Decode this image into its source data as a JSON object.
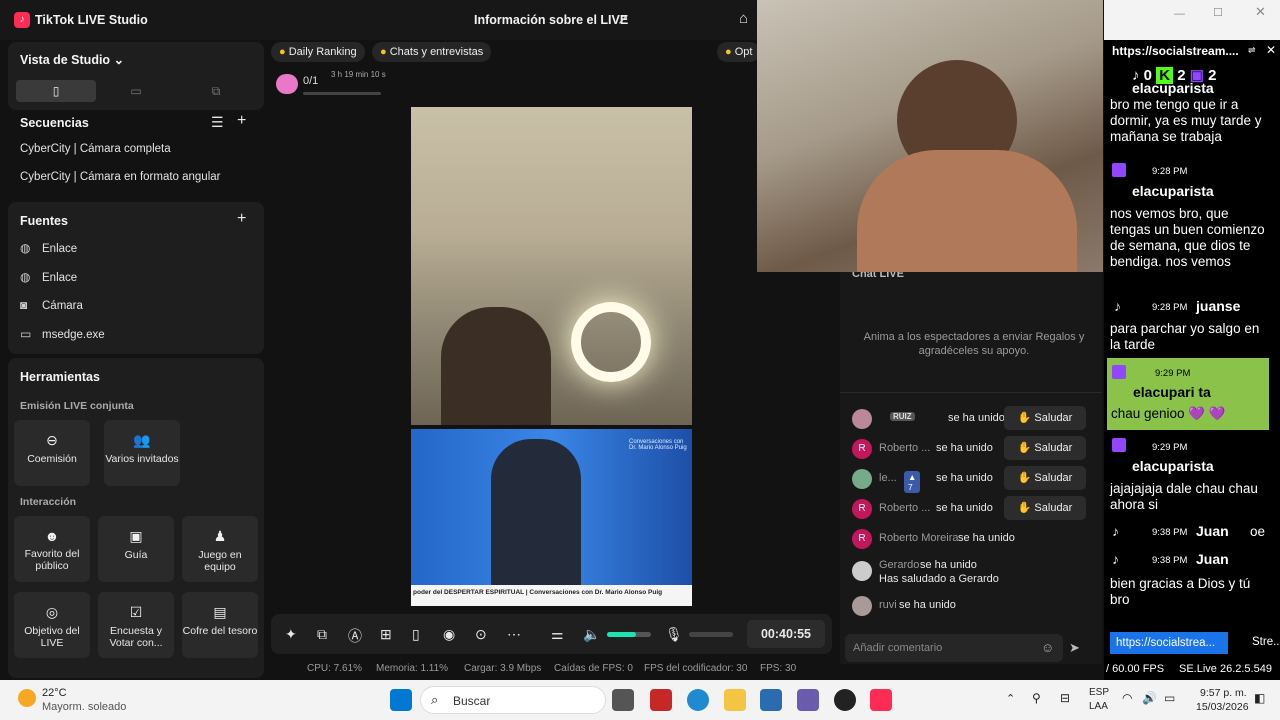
{
  "app": {
    "title": "TikTok LIVE Studio",
    "live_info": "Información sobre el LIVE",
    "options": "Opt"
  },
  "studio_view": {
    "label": "Vista de Studio"
  },
  "sequences": {
    "title": "Secuencias",
    "items": [
      "CyberCity | Cámara completa",
      "CyberCity | Cámara en formato angular"
    ]
  },
  "sources": {
    "title": "Fuentes",
    "items": [
      {
        "icon": "globe-icon",
        "label": "Enlace"
      },
      {
        "icon": "globe-icon",
        "label": "Enlace"
      },
      {
        "icon": "camera-icon",
        "label": "Cámara"
      },
      {
        "icon": "window-icon",
        "label": "msedge.exe"
      }
    ]
  },
  "tools": {
    "title": "Herramientas",
    "section1": "Emisión LIVE conjunta",
    "section2": "Interacción",
    "cohost": "Coemisión",
    "guests": "Varios invitados",
    "favorite": "Favorito del público",
    "guide": "Guía",
    "team": "Juego en equipo",
    "goal": "Objetivo del LIVE",
    "poll": "Encuesta y Votar con...",
    "chest": "Cofre del tesoro"
  },
  "chips": {
    "ranking": "Daily Ranking",
    "chats": "Chats y entrevistas",
    "progress": "0/1",
    "timer": "3 h 19 min 10 s"
  },
  "preview": {
    "caption": "poder del DESPERTAR ESPIRITUAL | Conversaciones con Dr. Mario Alonso Puig",
    "badge": "Conversaciones con Dr. Mario Alonso Puig"
  },
  "chat": {
    "header": "Chat LIVE",
    "empty": "Anima a los espectadores a enviar Regalos y agradéceles su apoyo.",
    "salute": "Saludar",
    "joined": "se ha unido",
    "rows": [
      {
        "name": "RUIZ",
        "av": ""
      },
      {
        "name": "Roberto ...",
        "av": "R"
      },
      {
        "name": "le...",
        "av": ""
      },
      {
        "name": "Roberto ...",
        "av": "R"
      },
      {
        "name": "Roberto Moreira",
        "av": "R"
      },
      {
        "name": "Gerardo",
        "av": ""
      },
      {
        "name": "ruvi",
        "av": ""
      }
    ],
    "badge_level": "7",
    "greeted": "Has saludado a Gerardo",
    "placeholder": "Añadir comentario"
  },
  "controls": {
    "time": "00:40:55"
  },
  "status": {
    "cpu": "CPU:  7.61%",
    "mem": "Memoria:  1.11%",
    "load": "Cargar:  3.9 Mbps",
    "fps_drop": "Caídas de FPS:  0",
    "enc_fps": "FPS del codificador:  30",
    "fps": "FPS:  30"
  },
  "overlay": {
    "url": "https://socialstream....",
    "counts": [
      "0",
      "2",
      "2"
    ],
    "messages": [
      {
        "time": "",
        "name": "elacuparista",
        "text": "bro me tengo que ir a dormir, ya es muy tarde y mañana se trabaja"
      },
      {
        "time": "9:28 PM",
        "name": "elacuparista",
        "text": "nos vemos bro, que tengas un buen comienzo de semana, que dios te bendiga. nos vemos"
      },
      {
        "time": "9:28 PM",
        "name": "juanse",
        "text": "para parchar yo salgo en la tarde"
      },
      {
        "time": "9:29 PM",
        "name": "elacupari ta",
        "text": "chau genioo 💜 💜"
      },
      {
        "time": "9:29 PM",
        "name": "elacuparista",
        "text": "jajajajaja dale chau chau ahora si"
      },
      {
        "time": "9:38 PM",
        "name": "Juan",
        "text": "oe"
      },
      {
        "time": "9:38 PM",
        "name": "Juan",
        "text": "bien gracias a Dios y tú bro"
      }
    ],
    "tab1": "https://socialstrea...",
    "tab2": "Stre...",
    "fps": "/ 60.00 FPS",
    "version": "SE.Live 26.2.5.549"
  },
  "taskbar": {
    "temp": "22°C",
    "weather": "Mayorm. soleado",
    "search": "Buscar",
    "lang1": "ESP",
    "lang2": "LAA",
    "time": "9:57 p. m.",
    "date": "15/03/2026"
  },
  "colors": {
    "accent": "#fe2c55",
    "twitch": "#9146ff",
    "highlight": "#8bc34a"
  }
}
